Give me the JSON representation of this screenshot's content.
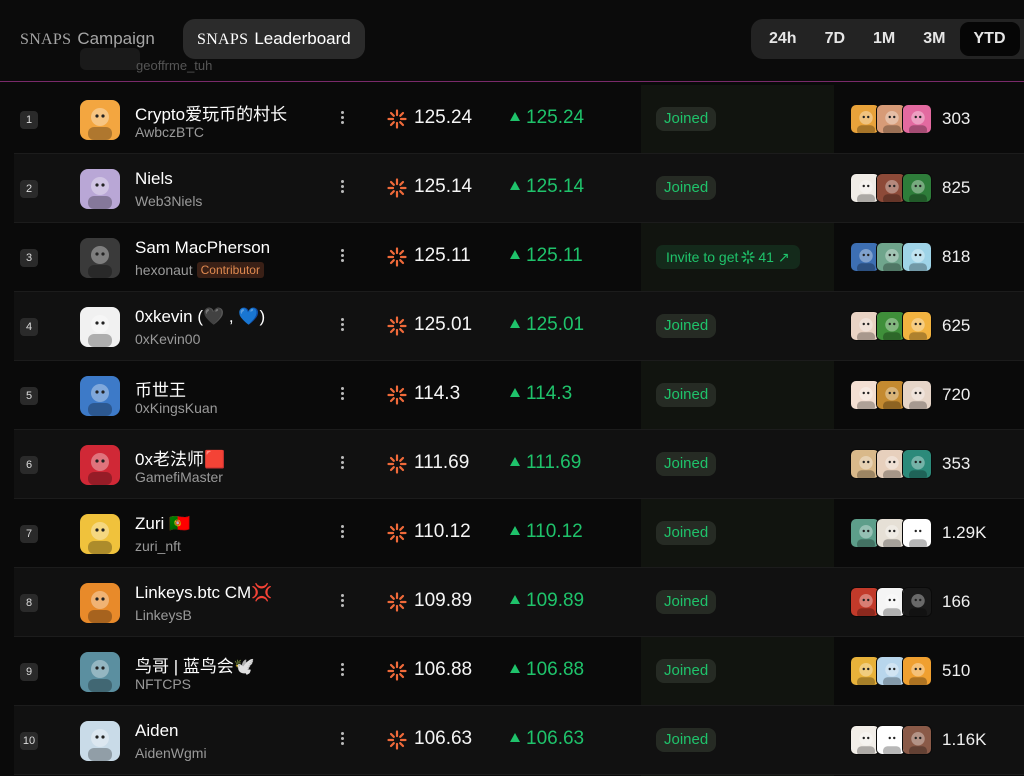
{
  "nav": {
    "campaign": {
      "brand": "SNAPS",
      "label": "Campaign"
    },
    "leaderboard": {
      "brand": "SNAPS",
      "label": "Leaderboard"
    }
  },
  "ranges": [
    "24h",
    "7D",
    "1M",
    "3M",
    "YTD"
  ],
  "active_range": "YTD",
  "accent_green": "#1fc36b",
  "accent_orange": "#f06a3a",
  "rows": [
    {
      "rank": "1",
      "name": "Crypto爱玩币的村长",
      "handle": "AwbczBTC",
      "badge": "",
      "score": "125.24",
      "delta": "125.24",
      "status": "Joined",
      "count": "303",
      "avatar": "#f3a640",
      "minis": [
        "#e8a23a",
        "#d79b77",
        "#e36aa0"
      ]
    },
    {
      "rank": "2",
      "name": "Niels",
      "handle": "Web3Niels",
      "badge": "",
      "score": "125.14",
      "delta": "125.14",
      "status": "Joined",
      "count": "825",
      "avatar": "#b9a7d6",
      "minis": [
        "#f0ece6",
        "#8d4a38",
        "#2e7d3a"
      ]
    },
    {
      "rank": "3",
      "name": "Sam MacPherson",
      "handle": "hexonaut",
      "badge": "Contributor",
      "score": "125.11",
      "delta": "125.11",
      "status": "invite",
      "count": "818",
      "avatar": "#3a3a3a",
      "minis": [
        "#3d6fb3",
        "#6fa58c",
        "#9fd4e8"
      ]
    },
    {
      "rank": "4",
      "name": "0xkevin (🖤 , 💙)",
      "handle": "0xKevin00",
      "badge": "",
      "score": "125.01",
      "delta": "125.01",
      "status": "Joined",
      "count": "625",
      "avatar": "#f1f1f1",
      "minis": [
        "#e9d3c4",
        "#3f8f3a",
        "#f2b340"
      ]
    },
    {
      "rank": "5",
      "name": "币世王",
      "handle": "0xKingsKuan",
      "badge": "",
      "score": "114.3",
      "delta": "114.3",
      "status": "Joined",
      "count": "720",
      "avatar": "#3d7ac8",
      "minis": [
        "#f3dfd2",
        "#c48a30",
        "#e6d5c8"
      ]
    },
    {
      "rank": "6",
      "name": "0x老法师🟥",
      "handle": "GamefiMaster",
      "badge": "",
      "score": "111.69",
      "delta": "111.69",
      "status": "Joined",
      "count": "353",
      "avatar": "#d02836",
      "minis": [
        "#d9b98a",
        "#e7d0bd",
        "#2c8a7a"
      ]
    },
    {
      "rank": "7",
      "name": "Zuri 🇵🇹",
      "handle": "zuri_nft",
      "badge": "",
      "score": "110.12",
      "delta": "110.12",
      "status": "Joined",
      "count": "1.29K",
      "avatar": "#f0c23c",
      "minis": [
        "#5d9e8a",
        "#e6e0d6",
        "#ffffff"
      ]
    },
    {
      "rank": "8",
      "name": "Linkeys.btc CM💢",
      "handle": "LinkeysB",
      "badge": "",
      "score": "109.89",
      "delta": "109.89",
      "status": "Joined",
      "count": "166",
      "avatar": "#e88a2a",
      "minis": [
        "#c23a2a",
        "#f5f5f5",
        "#1a1a1a"
      ]
    },
    {
      "rank": "9",
      "name": "鸟哥 | 蓝鸟会🕊️",
      "handle": "NFTCPS",
      "badge": "",
      "score": "106.88",
      "delta": "106.88",
      "status": "Joined",
      "count": "510",
      "avatar": "#5b8fa0",
      "minis": [
        "#e8b23a",
        "#b8d6ec",
        "#f0a030"
      ]
    },
    {
      "rank": "10",
      "name": "Aiden",
      "handle": "AidenWgmi",
      "badge": "",
      "score": "106.63",
      "delta": "106.63",
      "status": "Joined",
      "count": "1.16K",
      "avatar": "#c9dbe8",
      "minis": [
        "#f2eee8",
        "#ffffff",
        "#8a5a48"
      ]
    }
  ],
  "invite": {
    "label": "Invite to get",
    "amount": "41",
    "arrow": "↗"
  },
  "ghost_handle": "geoffrme_tuh"
}
